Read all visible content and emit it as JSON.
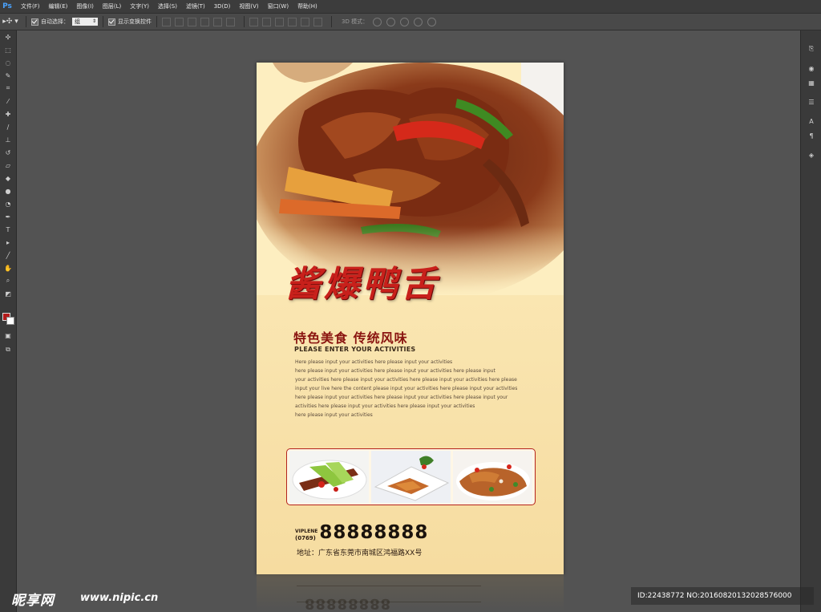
{
  "app": {
    "logo": "Ps"
  },
  "menu": [
    "文件(F)",
    "编辑(E)",
    "图像(I)",
    "图层(L)",
    "文字(Y)",
    "选择(S)",
    "滤镜(T)",
    "3D(D)",
    "视图(V)",
    "窗口(W)",
    "帮助(H)"
  ],
  "options": {
    "auto_select_label": "自动选择：",
    "auto_select_value": "组",
    "show_transform_label": "显示变换控件",
    "mode3d_label": "3D 模式："
  },
  "poster": {
    "title": "酱爆鸭舌",
    "slogan": "特色美食 传统风味",
    "slogan_en": "PLEASE ENTER YOUR ACTIVITIES",
    "body_lines": [
      "Here please input your activities here please input your activities",
      "here please input your activities here please input your activities here please input",
      "your activities here please input your activities here please input your activities here please",
      "input your live here the content please input your activities here please input your activities",
      "here please input your activities here please input your activities here please input your",
      "activities here please input your activities here please input your activities",
      "here please input your activities"
    ],
    "vip_label": "VIPLENE",
    "area_code": "(0769)",
    "phone": "88888888",
    "address": "地址：广东省东莞市南城区鸿福路XX号"
  },
  "watermark": {
    "logo": "昵享网",
    "url": "www.nipic.cn",
    "id": "ID:22438772 NO:20160820132028576000"
  },
  "colors": {
    "accent_red": "#c8201b",
    "dark_red": "#8a1410",
    "workspace": "#535353"
  }
}
